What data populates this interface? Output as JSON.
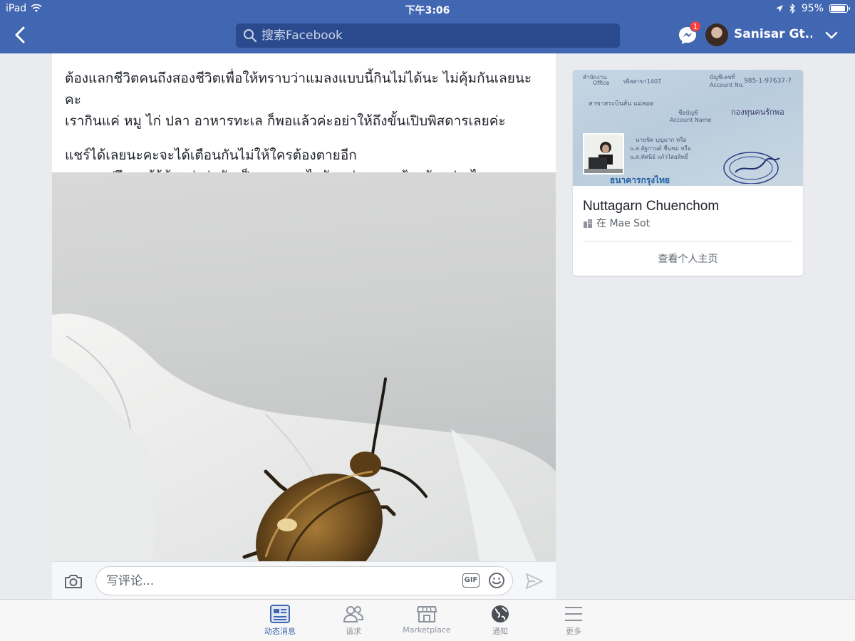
{
  "status_bar": {
    "device": "iPad",
    "time": "下午3:06",
    "battery": "95%",
    "battery_level": 0.95
  },
  "nav": {
    "search_placeholder": "搜索Facebook",
    "messenger_badge": "1",
    "user_name": "Sanisar Gt..."
  },
  "post": {
    "paragraph1_line1": "ต้องแลกชีวิตคนถึงสองชีวิตเพื่อให้ทราบว่าแมลงแบบนี้กินไม่ได้นะ ไม่คุ้มกันเลยนะคะ",
    "paragraph1_line2": "เรากินแค่ หมู ไก่ ปลา อาหารทะเล ก็พอแล้วค่ะอย่าให้ถึงขั้นเปิบพิสดารเลยค่ะ",
    "paragraph2_line1": "แชร์ได้เลยนะคะจะได้เตือนกันไม่ให้ใครต้องตายอีก",
    "paragraph2_line2": "และขอปรึกษาผู้รู้ด้วยค่ะว่ามันเป็นแมลงอะไรกันแน่ และจะป้องกันอย่างไร",
    "comment_placeholder": "写评论...",
    "gif_label": "GIF"
  },
  "profile_card": {
    "name": "Nuttagarn Chuenchom",
    "location": "在 Mae Sot",
    "view_profile": "查看个人主页",
    "cover_text": {
      "office_th": "สำนักงาน",
      "office_en": "Office",
      "branch": "รพิสสาขา1407",
      "account_no_th": "บัญชีเลขที่",
      "account_no_en": "Account No.",
      "account_no": "985-1-97637-7",
      "branch_name": "สาขาสระบินส์น แม่สอด",
      "account_name_th": "ชื่อบัญชี",
      "account_name_en": "Account Name",
      "account_name": "กองทุนคนรักพอ",
      "signer1": "นายชิต บุญมาก หรือ",
      "signer2": "น.ส.อัฐกานต์ ชื่นชม หรือ",
      "signer3": "น.ส.ทัศนีย์ แก้วไสยสิทธิ์",
      "bank": "ธนาคารกรุงไทย"
    }
  },
  "tabs": [
    {
      "label": "动态消息",
      "active": true
    },
    {
      "label": "请求",
      "active": false
    },
    {
      "label": "Marketplace",
      "active": false
    },
    {
      "label": "通知",
      "active": false
    },
    {
      "label": "更多",
      "active": false
    }
  ],
  "colors": {
    "facebook_blue": "#4267b2",
    "search_bg": "#2a4a8d",
    "badge_red": "#fa3e3e",
    "page_bg": "#e9ebee"
  }
}
